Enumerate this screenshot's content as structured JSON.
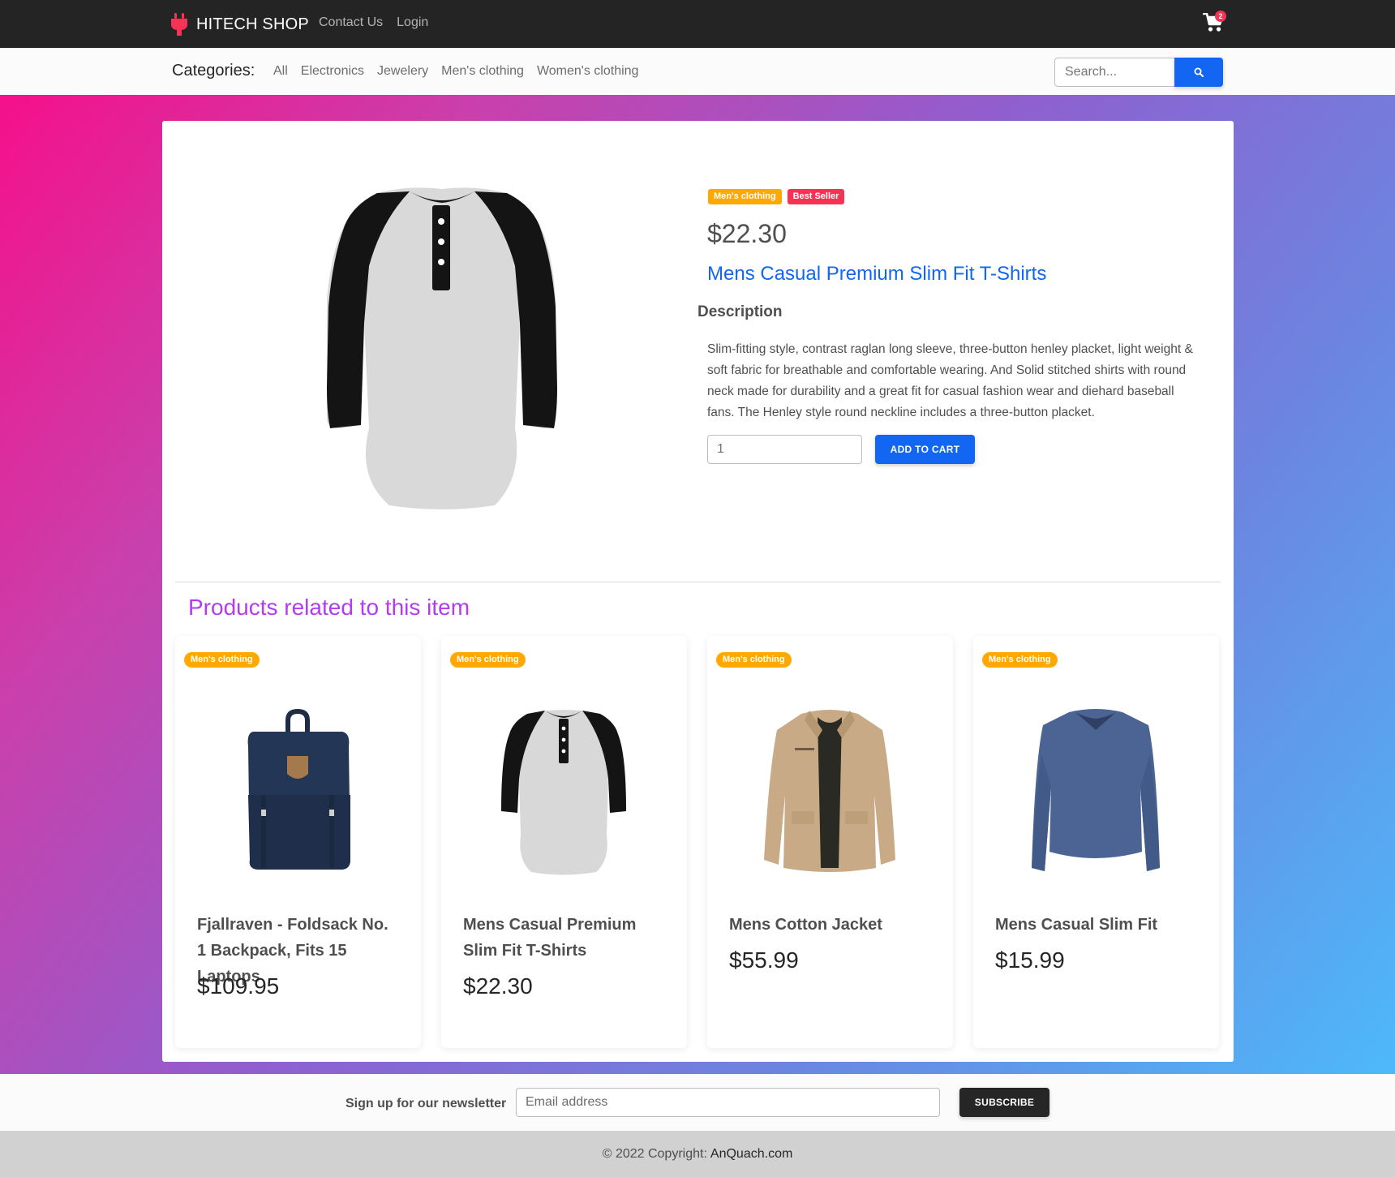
{
  "navbar": {
    "brand": "HITECH SHOP",
    "links": [
      "Contact Us",
      "Login"
    ],
    "cart_count": "2"
  },
  "categories": {
    "title": "Categories:",
    "items": [
      "All",
      "Electronics",
      "Jewelery",
      "Men's clothing",
      "Women's clothing"
    ],
    "search_placeholder": "Search..."
  },
  "product": {
    "category_badge": "Men's clothing",
    "seller_badge": "Best Seller",
    "price": "$22.30",
    "title": "Mens Casual Premium Slim Fit T-Shirts",
    "description_heading": "Description",
    "description": "Slim-fitting style, contrast raglan long sleeve, three-button henley placket, light weight & soft fabric for breathable and comfortable wearing. And Solid stitched shirts with round neck made for durability and a great fit for casual fashion wear and diehard baseball fans. The Henley style round neckline includes a three-button placket.",
    "quantity": "1",
    "add_to_cart": "ADD TO CART"
  },
  "related": {
    "title": "Products related to this item",
    "items": [
      {
        "badge": "Men's clothing",
        "name": "Fjallraven - Foldsack No. 1 Backpack, Fits 15 Laptops",
        "price": "$109.95",
        "image": "backpack-icon"
      },
      {
        "badge": "Men's clothing",
        "name": "Mens Casual Premium Slim Fit T-Shirts",
        "price": "$22.30",
        "image": "raglan-shirt-icon"
      },
      {
        "badge": "Men's clothing",
        "name": "Mens Cotton Jacket",
        "price": "$55.99",
        "image": "jacket-icon"
      },
      {
        "badge": "Men's clothing",
        "name": "Mens Casual Slim Fit",
        "price": "$15.99",
        "image": "longsleeve-shirt-icon"
      }
    ]
  },
  "newsletter": {
    "label": "Sign up for our newsletter",
    "placeholder": "Email address",
    "button": "SUBSCRIBE"
  },
  "footer": {
    "copyright": "© 2022 Copyright:",
    "link": "AnQuach.com"
  },
  "colors": {
    "primary": "#1266f1",
    "warning": "#ffa900",
    "danger": "#f93154",
    "related_title": "#b23cf1",
    "navbar": "#242424"
  }
}
